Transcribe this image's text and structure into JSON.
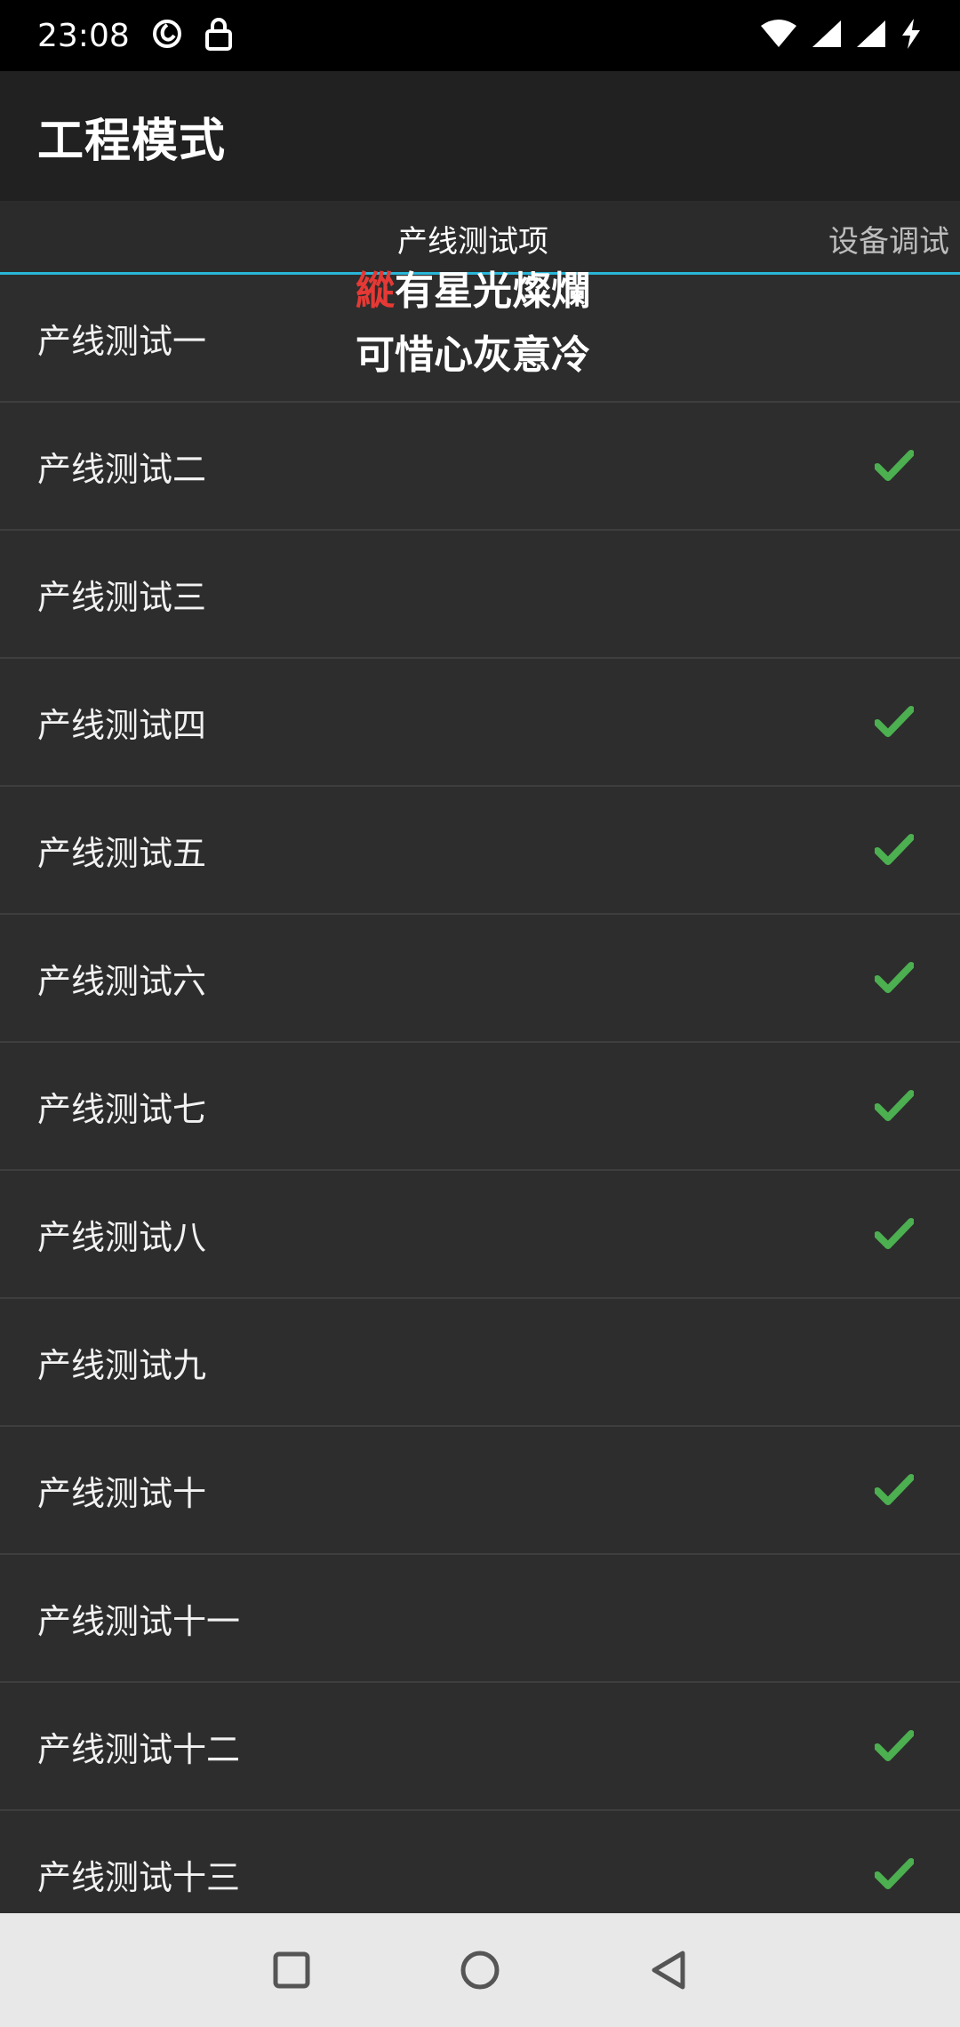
{
  "status_bar": {
    "time": "23:08",
    "icons": [
      "sync-icon",
      "lock-icon",
      "wifi-icon",
      "signal-icon",
      "signal-icon",
      "charging-icon"
    ]
  },
  "app_bar": {
    "title": "工程模式"
  },
  "tabs": [
    {
      "label": "产线测试项",
      "active": true
    },
    {
      "label": "设备调试",
      "active": false
    }
  ],
  "overlay": {
    "line1_first": "縱",
    "line1_rest": "有星光燦爛",
    "line2": "可惜心灰意冷"
  },
  "items": [
    {
      "label": "产线测试一",
      "checked": false
    },
    {
      "label": "产线测试二",
      "checked": true
    },
    {
      "label": "产线测试三",
      "checked": false
    },
    {
      "label": "产线测试四",
      "checked": true
    },
    {
      "label": "产线测试五",
      "checked": true
    },
    {
      "label": "产线测试六",
      "checked": true
    },
    {
      "label": "产线测试七",
      "checked": true
    },
    {
      "label": "产线测试八",
      "checked": true
    },
    {
      "label": "产线测试九",
      "checked": false
    },
    {
      "label": "产线测试十",
      "checked": true
    },
    {
      "label": "产线测试十一",
      "checked": false
    },
    {
      "label": "产线测试十二",
      "checked": true
    },
    {
      "label": "产线测试十三",
      "checked": true
    }
  ],
  "colors": {
    "check": "#4caf50",
    "tab_indicator": "#29b6d8",
    "overlay_accent": "#e53935"
  },
  "nav_bar": {
    "buttons": [
      "recents-button",
      "home-button",
      "back-button"
    ]
  }
}
